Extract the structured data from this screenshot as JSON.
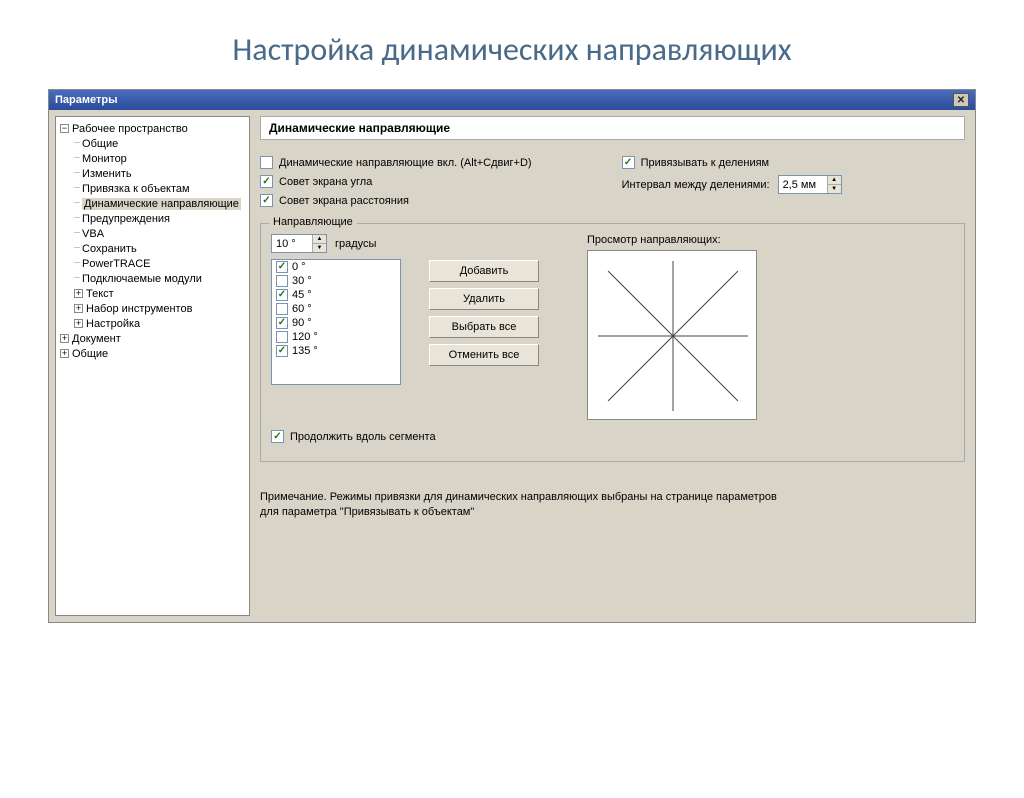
{
  "slide": {
    "title": "Настройка динамических направляющих"
  },
  "dialog": {
    "title": "Параметры"
  },
  "tree": {
    "root": "Рабочее пространство",
    "items": [
      "Общие",
      "Монитор",
      "Изменить",
      "Привязка к объектам",
      "Динамические направляющие",
      "Предупреждения",
      "VBA",
      "Сохранить",
      "PowerTRACE",
      "Подключаемые модули"
    ],
    "expandable": [
      "Текст",
      "Набор инструментов",
      "Настройка"
    ],
    "siblings": [
      "Документ",
      "Общие"
    ]
  },
  "panel": {
    "header": "Динамические направляющие",
    "ck_enable": "Динамические направляющие вкл. (Alt+Сдвиг+D)",
    "ck_snap_ticks": "Привязывать к делениям",
    "ck_angle_tip": "Совет экрана угла",
    "ck_dist_tip": "Совет экрана расстояния",
    "interval_label": "Интервал между делениями:",
    "interval_value": "2,5 мм",
    "guides": {
      "legend": "Направляющие",
      "deg_value": "10 °",
      "deg_unit": "градусы",
      "angles": [
        {
          "label": "0 °",
          "checked": true
        },
        {
          "label": "30 °",
          "checked": false
        },
        {
          "label": "45 °",
          "checked": true
        },
        {
          "label": "60 °",
          "checked": false
        },
        {
          "label": "90 °",
          "checked": true
        },
        {
          "label": "120 °",
          "checked": false
        },
        {
          "label": "135 °",
          "checked": true
        }
      ],
      "btn_add": "Добавить",
      "btn_del": "Удалить",
      "btn_all": "Выбрать все",
      "btn_none": "Отменить все",
      "ck_extend": "Продолжить вдоль сегмента",
      "preview_label": "Просмотр направляющих:"
    },
    "note": "Примечание. Режимы привязки для динамических направляющих выбраны на странице параметров для параметра \"Привязывать к объектам\""
  }
}
